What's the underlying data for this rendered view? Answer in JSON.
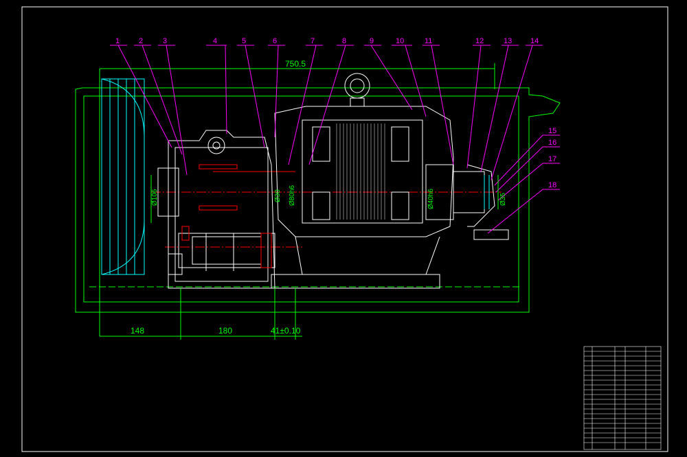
{
  "part_labels": [
    "1",
    "2",
    "3",
    "4",
    "5",
    "6",
    "7",
    "8",
    "9",
    "10",
    "11",
    "12",
    "13",
    "14",
    "15",
    "16",
    "17",
    "18"
  ],
  "dimensions": {
    "overall_length": "750.5",
    "pulley_offset": "148",
    "housing_length": "180",
    "tolerance_gap": "41±0.10",
    "dia_left": "Ø106",
    "dia_small": "Ø30",
    "dia_center": "Ø80h6",
    "dia_right_a": "Ø40h6",
    "dia_right_b": "Ø35"
  },
  "colors": {
    "background": "#000000",
    "outline": "#ffffff",
    "dimension": "#00ff00",
    "leader": "#ff00ff",
    "hidden": "#00ffff",
    "section": "#ff0000"
  },
  "title_block": {
    "rows": [
      "",
      "",
      "",
      "",
      "",
      "",
      "",
      "",
      "",
      "",
      "",
      "",
      "",
      "",
      "",
      "",
      "",
      "",
      "",
      ""
    ]
  }
}
